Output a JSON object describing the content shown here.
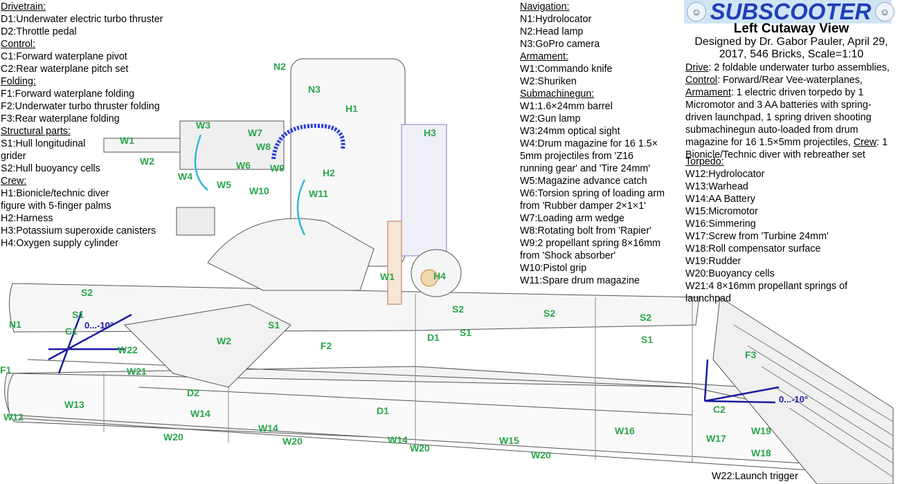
{
  "header": {
    "logo_text": "SUBSCOOTER",
    "view_title": "Left Cutaway View",
    "designer": "Designed by Dr. Gabor Pauler, April 29, 2017, 546 Bricks, Scale=1:10",
    "description": [
      {
        "head": "Drive",
        "text": ": 2 foldable underwater turbo assemblies, "
      },
      {
        "head": "Control",
        "text": ": Forward/Rear Vee-waterplanes, "
      },
      {
        "head": "Armament",
        "text": ": 1 electric driven torpedo by 1 Micromotor and 3 AA batteries with spring-driven launchpad, 1 spring driven shooting submachinegun auto-loaded from drum magazine for 16 1.5×5mm projectiles, "
      },
      {
        "head": "Crew",
        "text": ": 1 Bionicle/Technic diver with rebreather set"
      }
    ]
  },
  "legend_left": {
    "drivetrain": {
      "heading": "Drivetrain:",
      "items": [
        "D1:Underwater electric turbo thruster",
        "D2:Throttle pedal"
      ]
    },
    "control": {
      "heading": "Control:",
      "items": [
        "C1:Forward waterplane pivot",
        "C2:Rear waterplane pitch set"
      ]
    },
    "folding": {
      "heading": "Folding:",
      "items": [
        "F1:Forward waterplane folding",
        "F2:Underwater turbo thruster folding",
        "F3:Rear waterplane folding"
      ]
    },
    "structural": {
      "heading": "Structural parts:",
      "items": [
        "S1:Hull longitudinal",
        "grider",
        "S2:Hull buoyancy cells"
      ]
    },
    "crew": {
      "heading": "Crew:",
      "items": [
        "H1:Bionicle/technic diver",
        "figure with 5-finger palms",
        "H2:Harness",
        "H3:Potassium superoxide canisters",
        "H4:Oxygen supply cylinder"
      ]
    }
  },
  "legend_middle": {
    "navigation": {
      "heading": "Navigation:",
      "items": [
        "N1:Hydrolocator",
        "N2:Head lamp",
        "N3:GoPro camera"
      ]
    },
    "armament": {
      "heading": "Armament:",
      "items": [
        "W1:Commando knife",
        "W2:Shuriken"
      ]
    },
    "submachinegun": {
      "heading": "Submachinegun:",
      "items": [
        "W1:1.6×24mm barrel",
        "W2:Gun lamp",
        "W3:24mm optical sight",
        "W4:Drum magazine for 16 1.5×",
        "5mm projectiles from 'Z16",
        "running gear' and 'Tire 24mm'",
        "W5:Magazine advance catch",
        "W6:Torsion spring of loading arm",
        "from 'Rubber damper 2×1×1'",
        "W7:Loading arm wedge",
        "W8:Rotating bolt from 'Rapier'",
        "W9:2 propellant spring 8×16mm",
        "from 'Shock absorber'",
        "W10:Pistol grip",
        "W11:Spare drum magazine"
      ]
    }
  },
  "legend_right": {
    "torpedo": {
      "heading": "Torpedo:",
      "items": [
        "W12:Hydrolocator",
        "W13:Warhead",
        "W14:AA Battery",
        "W15:Micromotor",
        "W16:Simmering",
        "W17:Screw from 'Turbine 24mm'",
        "W18:Roll compensator surface",
        "W19:Rudder",
        "W20:Buoyancy cells",
        "W21:4 8×16mm propellant springs of",
        "launchpad"
      ]
    },
    "trigger": "W22:Launch trigger"
  },
  "angles": {
    "forward": "0...-10°",
    "rear": "0...-10°"
  },
  "callouts": [
    "N2",
    "N3",
    "H1",
    "H3",
    "W3",
    "W7",
    "W1",
    "W8",
    "W2",
    "W6",
    "W9",
    "H2",
    "W4",
    "W5",
    "W10",
    "W11",
    "W1",
    "H4",
    "S2",
    "S2",
    "S2",
    "S2",
    "N1",
    "S1",
    "C1",
    "S1",
    "S1",
    "S1",
    "W2",
    "F2",
    "D1",
    "F3",
    "W22",
    "W21",
    "F1",
    "D2",
    "W13",
    "W12",
    "W14",
    "D1",
    "W14",
    "W20",
    "W20",
    "W14",
    "W20",
    "W15",
    "W20",
    "W16",
    "C2",
    "W17",
    "W19",
    "W18"
  ],
  "colors": {
    "label_green": "#2aa54a",
    "angle_blue": "#1a1aa0",
    "hose_blue": "#2a3fd8",
    "cyan_loop": "#30b8d8",
    "logo_blue": "#1f3fb8"
  }
}
